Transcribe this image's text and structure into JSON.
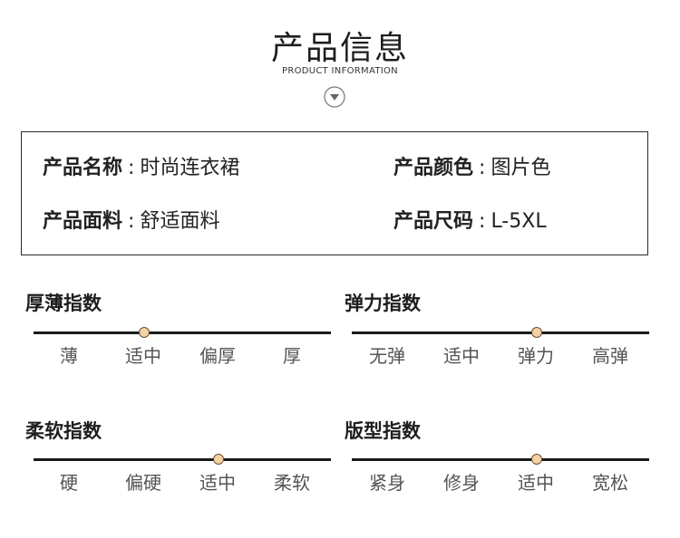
{
  "header": {
    "title": "产品信息",
    "subtitle": "PRODUCT INFORMATION",
    "icon": "chevron-down-circle-icon"
  },
  "info": {
    "name_label": "产品名称",
    "name_value": "时尚连衣裙",
    "color_label": "产品颜色",
    "color_value": "图片色",
    "fabric_label": "产品面料",
    "fabric_value": "舒适面料",
    "size_label": "产品尺码",
    "size_value": "L-5XL",
    "separator": ":"
  },
  "indices": {
    "thickness": {
      "title": "厚薄指数",
      "options": [
        "薄",
        "适中",
        "偏厚",
        "厚"
      ],
      "selected": "适中"
    },
    "elasticity": {
      "title": "弹力指数",
      "options": [
        "无弹",
        "适中",
        "弹力",
        "高弹"
      ],
      "selected": "弹力"
    },
    "softness": {
      "title": "柔软指数",
      "options": [
        "硬",
        "偏硬",
        "适中",
        "柔软"
      ],
      "selected": "适中"
    },
    "fit": {
      "title": "版型指数",
      "options": [
        "紧身",
        "修身",
        "适中",
        "宽松"
      ],
      "selected": "适中"
    }
  },
  "colors": {
    "accent_dot": "#f3d3a6",
    "line": "#1a1a1a",
    "border": "#2a2a2a"
  }
}
